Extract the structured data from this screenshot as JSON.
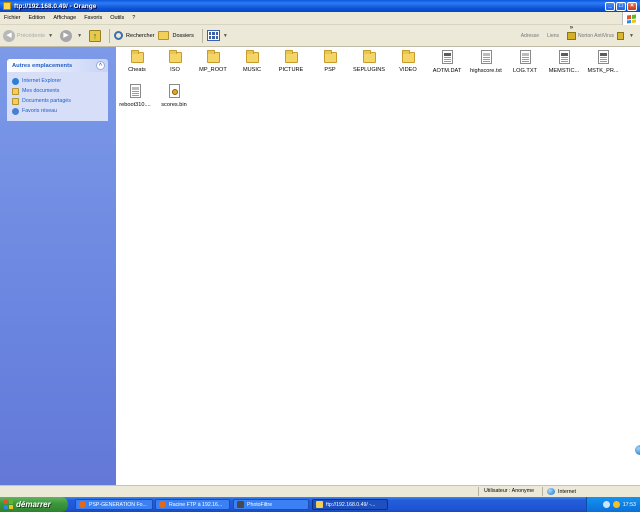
{
  "window": {
    "title": "ftp://192.168.0.49/ - Orange"
  },
  "menu": {
    "items": [
      "Fichier",
      "Edition",
      "Affichage",
      "Favoris",
      "Outils",
      "?"
    ]
  },
  "toolbar": {
    "back_label": "Précédente",
    "search_label": "Rechercher",
    "folders_label": "Dossiers",
    "address_label": "Adresse",
    "links_label": "Liens",
    "norton_label": "Norton AntiVirus"
  },
  "sidebar": {
    "panel_title": "Autres emplacements",
    "links": [
      {
        "label": "Internet Explorer",
        "icon": "internet-explorer-icon",
        "color": "#2d7fd6"
      },
      {
        "label": "Mes documents",
        "icon": "folder-icon",
        "color": "#f2cf5a"
      },
      {
        "label": "Documents partagés",
        "icon": "shared-folder-icon",
        "color": "#f2cf5a"
      },
      {
        "label": "Favoris réseau",
        "icon": "network-icon",
        "color": "#4a7fd0"
      }
    ]
  },
  "files": [
    {
      "name": "Cheats",
      "type": "folder"
    },
    {
      "name": "ISO",
      "type": "folder"
    },
    {
      "name": "MP_ROOT",
      "type": "folder"
    },
    {
      "name": "MUSIC",
      "type": "folder"
    },
    {
      "name": "PICTURE",
      "type": "folder"
    },
    {
      "name": "PSP",
      "type": "folder"
    },
    {
      "name": "SEPLUGINS",
      "type": "folder"
    },
    {
      "name": "VIDEO",
      "type": "folder"
    },
    {
      "name": "AOTM.DAT",
      "type": "file"
    },
    {
      "name": "highscore.txt",
      "type": "text"
    },
    {
      "name": "LOG.TXT",
      "type": "text"
    },
    {
      "name": "MEMSTIC...",
      "type": "file"
    },
    {
      "name": "MSTK_PR...",
      "type": "file"
    },
    {
      "name": "reboot310....",
      "type": "text"
    },
    {
      "name": "scores.bin",
      "type": "bin"
    }
  ],
  "status": {
    "user": "Utilisateur : Anonyme",
    "zone": "Internet"
  },
  "taskbar": {
    "start_label": "démarrer",
    "tasks": [
      {
        "label": "PSP-GENERATION Fo...",
        "icon_color": "#e06a1a"
      },
      {
        "label": "Racine FTP à 192.16...",
        "icon_color": "#e06a1a"
      },
      {
        "label": "PhotoFiltre",
        "icon_color": "#4a4a4a"
      },
      {
        "label": "ftp://192.168.0.49/ -...",
        "icon_color": "#f2cf5a"
      }
    ],
    "clock": "17:53"
  },
  "colors": {
    "titlebar": "#0a53d8",
    "sidebar": "#6a86e0",
    "link": "#215dc6",
    "start": "#3c963c"
  }
}
